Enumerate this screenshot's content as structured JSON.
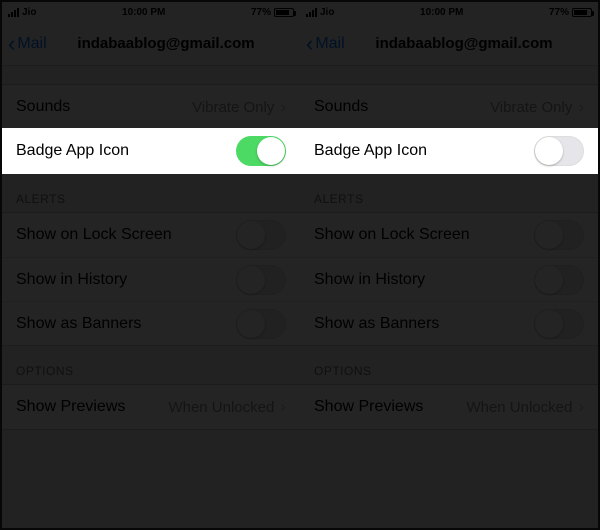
{
  "statusBar": {
    "carrier": "Jio",
    "time": "10:00 PM",
    "batteryPercent": "77%"
  },
  "nav": {
    "back": "Mail",
    "title": "indabaablog@gmail.com"
  },
  "rows": {
    "sounds": {
      "label": "Sounds",
      "value": "Vibrate Only"
    },
    "badge": {
      "label": "Badge App Icon"
    }
  },
  "sections": {
    "alerts": "ALERTS",
    "options": "OPTIONS"
  },
  "alerts": {
    "lockscreen": "Show on Lock Screen",
    "history": "Show in History",
    "banners": "Show as Banners"
  },
  "options": {
    "previews": {
      "label": "Show Previews",
      "value": "When Unlocked"
    }
  },
  "left": {
    "badgeOn": true
  },
  "right": {
    "badgeOn": false
  }
}
